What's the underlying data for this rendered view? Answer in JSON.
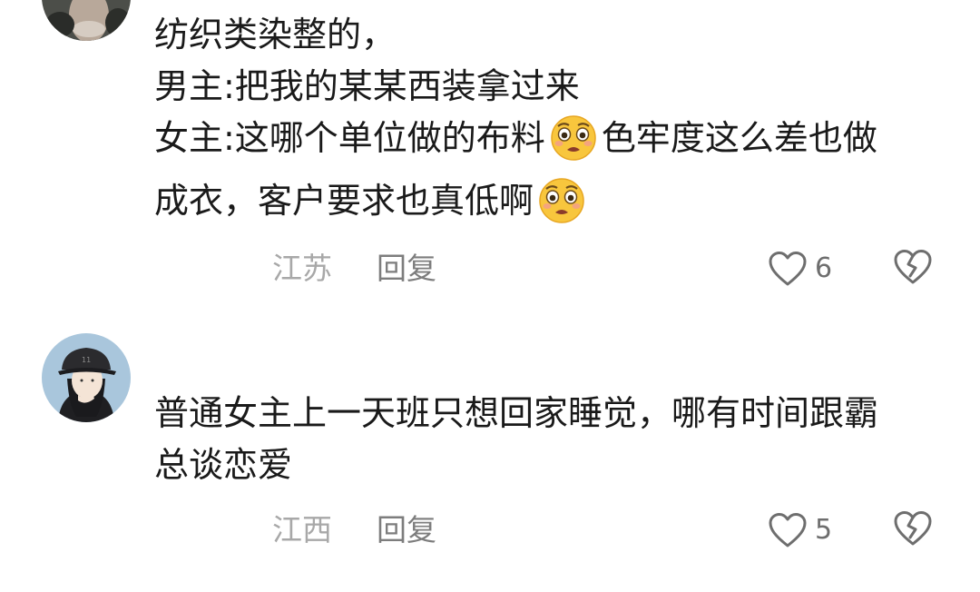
{
  "comments": [
    {
      "avatar_icon": "user-avatar-cat-icon",
      "lines": [
        "纺织类染整的，",
        "男主:把我的某某西装拿过来",
        "女主:这哪个单位做的布料",
        "色牢度这么差也做",
        "成衣，客户要求也真低啊"
      ],
      "emoji_icon": "pleading-face-emoji-icon",
      "location": "江苏",
      "reply_label": "回复",
      "like_count": "6"
    },
    {
      "avatar_icon": "user-avatar-girl-cap-icon",
      "lines": [
        "普通女主上一天班只想回家睡觉，哪有时间跟霸",
        "总谈恋爱"
      ],
      "location": "江西",
      "reply_label": "回复",
      "like_count": "5"
    }
  ],
  "icons": {
    "like": "heart-outline-icon",
    "dislike": "broken-heart-icon"
  },
  "colors": {
    "text": "#1a1a1a",
    "location": "#a8a8a8",
    "reply": "#7d7d7d",
    "icon": "#6e6e6e"
  }
}
